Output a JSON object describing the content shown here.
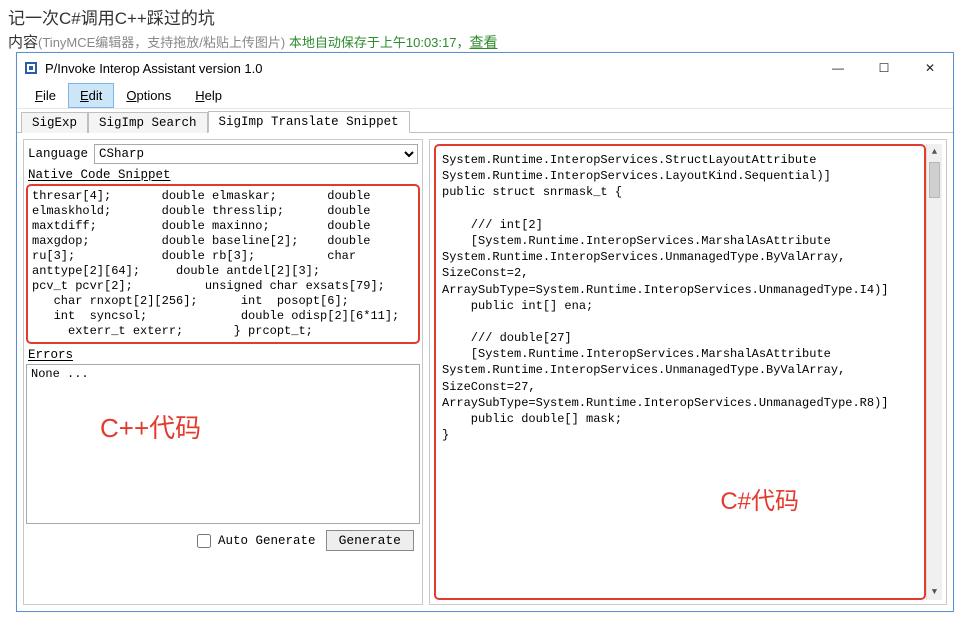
{
  "page": {
    "title": "记一次C#调用C++踩过的坑",
    "content_label": "内容",
    "content_hint": "(TinyMCE编辑器，支持拖放/粘贴上传图片)  ",
    "autosave_text": "本地自动保存于上午10:03:17，",
    "view_link": "查看"
  },
  "window": {
    "title": "P/Invoke Interop Assistant version 1.0",
    "minimize": "—",
    "maximize": "☐",
    "close": "✕"
  },
  "menu": {
    "file": "File",
    "edit": "Edit",
    "options": "Options",
    "help": "Help"
  },
  "tabs": {
    "sigexp": "SigExp",
    "sigimp_search": "SigImp Search",
    "sigimp_translate": "SigImp Translate Snippet"
  },
  "left": {
    "language_label": "Language",
    "language_value": "CSharp",
    "native_label": "Native Code Snippet",
    "native_code": "thresar[4];       double elmaskar;       double\nelmaskhold;       double thresslip;      double\nmaxtdiff;         double maxinno;        double\nmaxgdop;          double baseline[2];    double\nru[3];            double rb[3];          char\nanttype[2][64];     double antdel[2][3];\npcv_t pcvr[2];          unsigned char exsats[79];\n   char rnxopt[2][256];      int  posopt[6];\n   int  syncsol;             double odisp[2][6*11];\n     exterr_t exterr;       } prcopt_t;",
    "errors_label": "Errors",
    "errors_text": "None ...",
    "auto_generate": "Auto Generate",
    "generate": "Generate"
  },
  "right": {
    "output_code": "System.Runtime.InteropServices.StructLayoutAttribute\nSystem.Runtime.InteropServices.LayoutKind.Sequential)]\npublic struct snrmask_t {\n\n    /// int[2]\n    [System.Runtime.InteropServices.MarshalAsAttribute\nSystem.Runtime.InteropServices.UnmanagedType.ByValArray,\nSizeConst=2,\nArraySubType=System.Runtime.InteropServices.UnmanagedType.I4)]\n    public int[] ena;\n\n    /// double[27]\n    [System.Runtime.InteropServices.MarshalAsAttribute\nSystem.Runtime.InteropServices.UnmanagedType.ByValArray,\nSizeConst=27,\nArraySubType=System.Runtime.InteropServices.UnmanagedType.R8)]\n    public double[] mask;\n}"
  },
  "overlays": {
    "left_label": "C++代码",
    "right_label": "C#代码"
  }
}
